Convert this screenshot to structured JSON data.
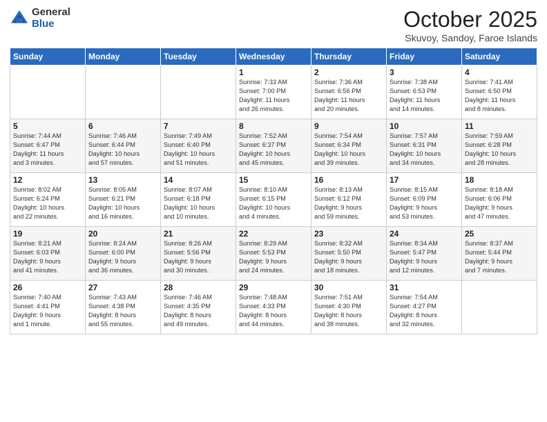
{
  "header": {
    "logo_general": "General",
    "logo_blue": "Blue",
    "month_title": "October 2025",
    "subtitle": "Skuvoy, Sandoy, Faroe Islands"
  },
  "weekdays": [
    "Sunday",
    "Monday",
    "Tuesday",
    "Wednesday",
    "Thursday",
    "Friday",
    "Saturday"
  ],
  "weeks": [
    [
      {
        "day": "",
        "info": ""
      },
      {
        "day": "",
        "info": ""
      },
      {
        "day": "",
        "info": ""
      },
      {
        "day": "1",
        "info": "Sunrise: 7:33 AM\nSunset: 7:00 PM\nDaylight: 11 hours\nand 26 minutes."
      },
      {
        "day": "2",
        "info": "Sunrise: 7:36 AM\nSunset: 6:56 PM\nDaylight: 11 hours\nand 20 minutes."
      },
      {
        "day": "3",
        "info": "Sunrise: 7:38 AM\nSunset: 6:53 PM\nDaylight: 11 hours\nand 14 minutes."
      },
      {
        "day": "4",
        "info": "Sunrise: 7:41 AM\nSunset: 6:50 PM\nDaylight: 11 hours\nand 8 minutes."
      }
    ],
    [
      {
        "day": "5",
        "info": "Sunrise: 7:44 AM\nSunset: 6:47 PM\nDaylight: 11 hours\nand 3 minutes."
      },
      {
        "day": "6",
        "info": "Sunrise: 7:46 AM\nSunset: 6:44 PM\nDaylight: 10 hours\nand 57 minutes."
      },
      {
        "day": "7",
        "info": "Sunrise: 7:49 AM\nSunset: 6:40 PM\nDaylight: 10 hours\nand 51 minutes."
      },
      {
        "day": "8",
        "info": "Sunrise: 7:52 AM\nSunset: 6:37 PM\nDaylight: 10 hours\nand 45 minutes."
      },
      {
        "day": "9",
        "info": "Sunrise: 7:54 AM\nSunset: 6:34 PM\nDaylight: 10 hours\nand 39 minutes."
      },
      {
        "day": "10",
        "info": "Sunrise: 7:57 AM\nSunset: 6:31 PM\nDaylight: 10 hours\nand 34 minutes."
      },
      {
        "day": "11",
        "info": "Sunrise: 7:59 AM\nSunset: 6:28 PM\nDaylight: 10 hours\nand 28 minutes."
      }
    ],
    [
      {
        "day": "12",
        "info": "Sunrise: 8:02 AM\nSunset: 6:24 PM\nDaylight: 10 hours\nand 22 minutes."
      },
      {
        "day": "13",
        "info": "Sunrise: 8:05 AM\nSunset: 6:21 PM\nDaylight: 10 hours\nand 16 minutes."
      },
      {
        "day": "14",
        "info": "Sunrise: 8:07 AM\nSunset: 6:18 PM\nDaylight: 10 hours\nand 10 minutes."
      },
      {
        "day": "15",
        "info": "Sunrise: 8:10 AM\nSunset: 6:15 PM\nDaylight: 10 hours\nand 4 minutes."
      },
      {
        "day": "16",
        "info": "Sunrise: 8:13 AM\nSunset: 6:12 PM\nDaylight: 9 hours\nand 59 minutes."
      },
      {
        "day": "17",
        "info": "Sunrise: 8:15 AM\nSunset: 6:09 PM\nDaylight: 9 hours\nand 53 minutes."
      },
      {
        "day": "18",
        "info": "Sunrise: 8:18 AM\nSunset: 6:06 PM\nDaylight: 9 hours\nand 47 minutes."
      }
    ],
    [
      {
        "day": "19",
        "info": "Sunrise: 8:21 AM\nSunset: 6:03 PM\nDaylight: 9 hours\nand 41 minutes."
      },
      {
        "day": "20",
        "info": "Sunrise: 8:24 AM\nSunset: 6:00 PM\nDaylight: 9 hours\nand 36 minutes."
      },
      {
        "day": "21",
        "info": "Sunrise: 8:26 AM\nSunset: 5:56 PM\nDaylight: 9 hours\nand 30 minutes."
      },
      {
        "day": "22",
        "info": "Sunrise: 8:29 AM\nSunset: 5:53 PM\nDaylight: 9 hours\nand 24 minutes."
      },
      {
        "day": "23",
        "info": "Sunrise: 8:32 AM\nSunset: 5:50 PM\nDaylight: 9 hours\nand 18 minutes."
      },
      {
        "day": "24",
        "info": "Sunrise: 8:34 AM\nSunset: 5:47 PM\nDaylight: 9 hours\nand 12 minutes."
      },
      {
        "day": "25",
        "info": "Sunrise: 8:37 AM\nSunset: 5:44 PM\nDaylight: 9 hours\nand 7 minutes."
      }
    ],
    [
      {
        "day": "26",
        "info": "Sunrise: 7:40 AM\nSunset: 4:41 PM\nDaylight: 9 hours\nand 1 minute."
      },
      {
        "day": "27",
        "info": "Sunrise: 7:43 AM\nSunset: 4:38 PM\nDaylight: 8 hours\nand 55 minutes."
      },
      {
        "day": "28",
        "info": "Sunrise: 7:46 AM\nSunset: 4:35 PM\nDaylight: 8 hours\nand 49 minutes."
      },
      {
        "day": "29",
        "info": "Sunrise: 7:48 AM\nSunset: 4:33 PM\nDaylight: 8 hours\nand 44 minutes."
      },
      {
        "day": "30",
        "info": "Sunrise: 7:51 AM\nSunset: 4:30 PM\nDaylight: 8 hours\nand 38 minutes."
      },
      {
        "day": "31",
        "info": "Sunrise: 7:54 AM\nSunset: 4:27 PM\nDaylight: 8 hours\nand 32 minutes."
      },
      {
        "day": "",
        "info": ""
      }
    ]
  ]
}
